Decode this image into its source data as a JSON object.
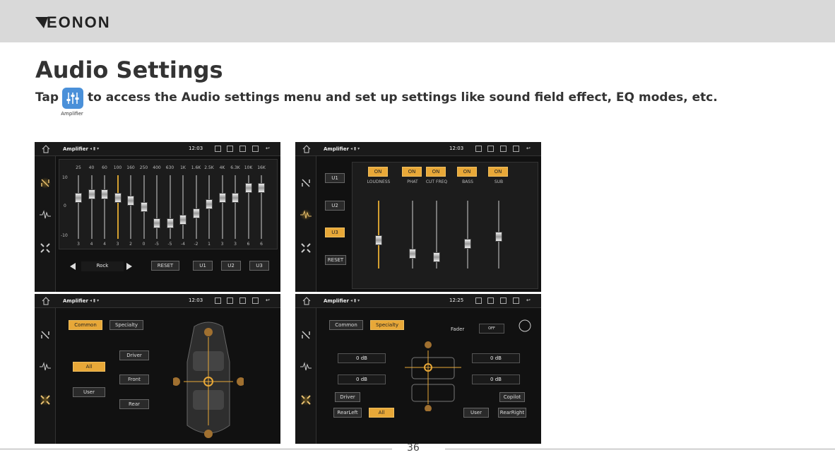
{
  "header": {
    "logo": "EONON"
  },
  "page": {
    "title": "Audio Settings",
    "subtitle_prefix": "Tap",
    "subtitle_rest": "to access the Audio settings menu and set up settings like sound field effect, EQ modes, etc.",
    "app_icon_label": "Amplifier",
    "page_number": "36"
  },
  "statusbar": {
    "title": "Amplifier",
    "time1": "12:03",
    "time4": "12:25"
  },
  "eq": {
    "freqs": [
      "25",
      "40",
      "60",
      "100",
      "160",
      "250",
      "400",
      "630",
      "1K",
      "1.6K",
      "2.5K",
      "4K",
      "6.3K",
      "10K",
      "16K"
    ],
    "values": [
      "3",
      "4",
      "4",
      "3",
      "2",
      "0",
      "-5",
      "-5",
      "-4",
      "-2",
      "1",
      "3",
      "3",
      "6",
      "6"
    ],
    "levels": [
      3,
      4,
      4,
      3,
      2,
      0,
      -5,
      -5,
      -4,
      -2,
      1,
      3,
      3,
      6,
      6
    ],
    "scale": [
      "10",
      "0",
      "-10"
    ],
    "preset": "Rock",
    "reset": "RESET",
    "user1": "U1",
    "user2": "U2",
    "user3": "U3"
  },
  "loudness": {
    "presets": [
      "U1",
      "U2",
      "U3"
    ],
    "reset": "RESET",
    "on": "ON",
    "groups": [
      "LOUDNESS",
      "PHAT",
      "CUT FREQ",
      "BASS",
      "SUB"
    ]
  },
  "field": {
    "common": "Common",
    "specialty": "Specialty",
    "driver": "Driver",
    "all": "All",
    "front": "Front",
    "user": "User",
    "rear": "Rear"
  },
  "spec": {
    "common": "Common",
    "specialty": "Specialty",
    "fader": "Fader",
    "off": "OFF",
    "db": "0 dB",
    "driver": "Driver",
    "copilot": "Copilot",
    "rearleft": "RearLeft",
    "all": "All",
    "user": "User",
    "rearright": "RearRight"
  }
}
